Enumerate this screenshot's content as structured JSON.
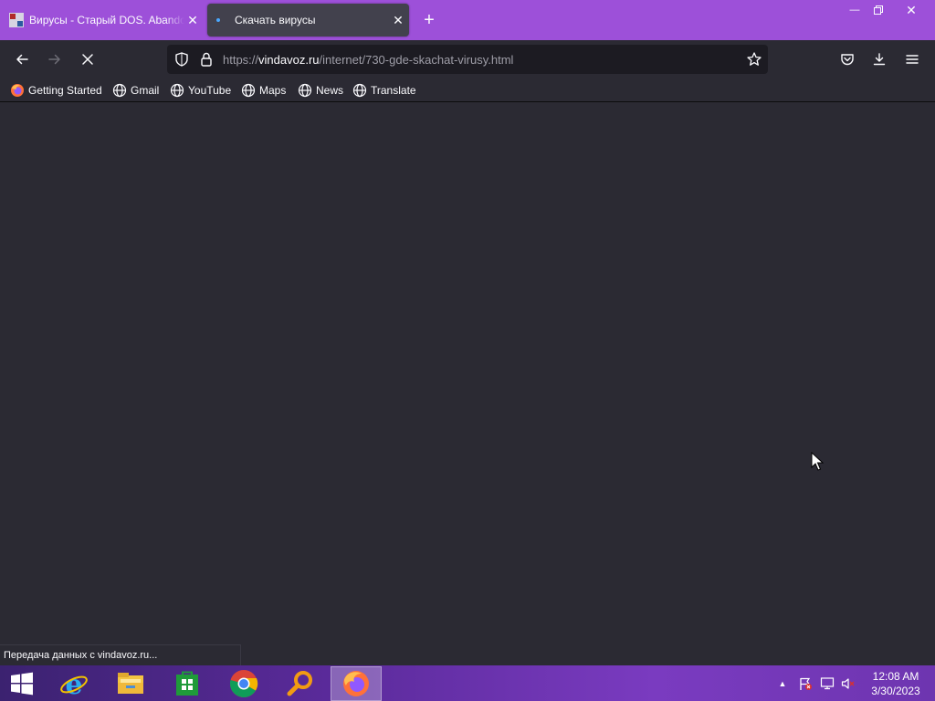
{
  "browser": {
    "tabs": [
      {
        "title": "Вирусы - Старый DOS. Abandonware",
        "active": false
      },
      {
        "title": "Скачать вирусы",
        "active": true,
        "loading": true
      }
    ],
    "new_tab_label": "+",
    "url": {
      "scheme": "https://",
      "host": "vindavoz.ru",
      "path": "/internet/730-gde-skachat-virusy.html"
    },
    "bookmarks": [
      {
        "label": "Getting Started",
        "icon": "firefox-icon"
      },
      {
        "label": "Gmail",
        "icon": "globe-icon"
      },
      {
        "label": "YouTube",
        "icon": "globe-icon"
      },
      {
        "label": "Maps",
        "icon": "globe-icon"
      },
      {
        "label": "News",
        "icon": "globe-icon"
      },
      {
        "label": "Translate",
        "icon": "globe-icon"
      }
    ],
    "status_text": "Передача данных с vindavoz.ru..."
  },
  "taskbar": {
    "apps": [
      "start",
      "internet-explorer",
      "file-explorer",
      "store",
      "chrome",
      "search",
      "firefox"
    ],
    "active_app": "firefox",
    "time": "12:08 AM",
    "date": "3/30/2023"
  },
  "colors": {
    "tabstrip": "#9d50d9",
    "toolbar": "#2b2a33",
    "urlbar": "#1c1b22",
    "active_tab": "#42414d",
    "text": "#fbfbfe",
    "taskbar_accent": "#7a3bc0"
  }
}
